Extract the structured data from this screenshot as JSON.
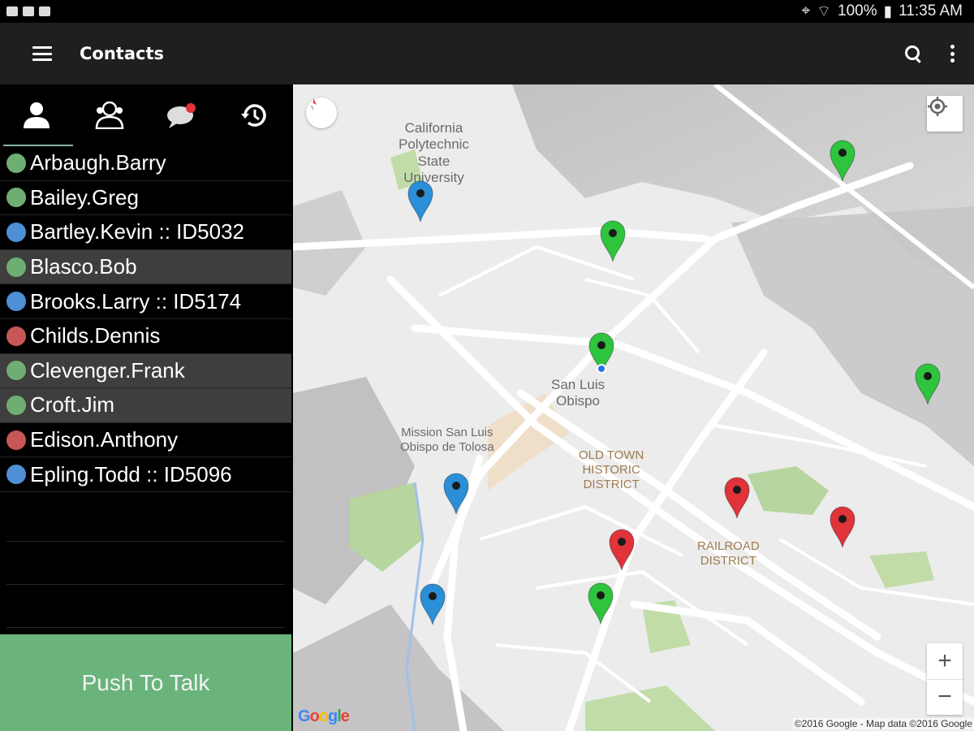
{
  "status_bar": {
    "battery": "100%",
    "time": "11:35 AM"
  },
  "app_bar": {
    "title": "Contacts"
  },
  "tabs": [
    {
      "name": "contacts",
      "icon": "person-icon"
    },
    {
      "name": "groups",
      "icon": "group-icon"
    },
    {
      "name": "messages",
      "icon": "chat-icon"
    },
    {
      "name": "history",
      "icon": "history-icon"
    }
  ],
  "contacts": [
    {
      "label": "Arbaugh.Barry",
      "status_color": "#6fae73",
      "selected": false
    },
    {
      "label": "Bailey.Greg",
      "status_color": "#6fae73",
      "selected": false
    },
    {
      "label": "Bartley.Kevin :: ID5032",
      "status_color": "#4f8fd6",
      "selected": false
    },
    {
      "label": "Blasco.Bob",
      "status_color": "#6fae73",
      "selected": true
    },
    {
      "label": "Brooks.Larry :: ID5174",
      "status_color": "#4f8fd6",
      "selected": false
    },
    {
      "label": "Childs.Dennis",
      "status_color": "#c95656",
      "selected": false
    },
    {
      "label": "Clevenger.Frank",
      "status_color": "#6fae73",
      "selected": true
    },
    {
      "label": "Croft.Jim",
      "status_color": "#6fae73",
      "selected": true
    },
    {
      "label": "Edison.Anthony",
      "status_color": "#c95656",
      "selected": false
    },
    {
      "label": "Epling.Todd :: ID5096",
      "status_color": "#4f8fd6",
      "selected": false
    }
  ],
  "push_to_talk": {
    "label": "Push To Talk"
  },
  "map": {
    "labels": {
      "cal_poly": "California\nPolytechnic\nState\nUniversity",
      "san_luis": "San Luis\nObispo",
      "mission": "Mission San Luis\nObispo de Tolosa",
      "old_town": "OLD TOWN\nHISTORIC\nDISTRICT",
      "railroad": "RAILROAD\nDISTRICT"
    },
    "zoom_in": "+",
    "zoom_out": "−",
    "google": "Google",
    "attribution": "©2016 Google - Map data ©2016 Google"
  },
  "pin_colors": {
    "green": "#2ec43e",
    "blue": "#2a8fd6",
    "red": "#e0333a"
  }
}
